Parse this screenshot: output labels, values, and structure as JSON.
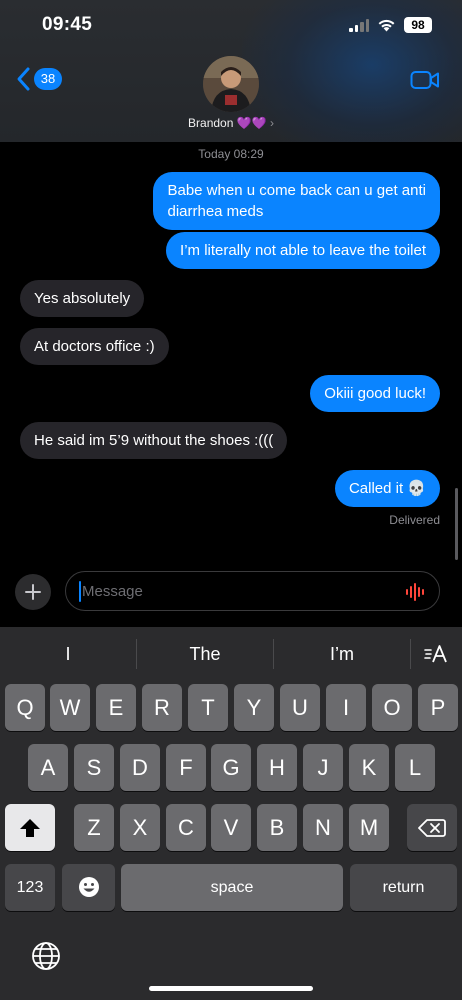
{
  "status_bar": {
    "time": "09:45",
    "battery": "98"
  },
  "header": {
    "back_badge": "38",
    "contact_name": "Brandon 💜💜",
    "contact_chevron": "›"
  },
  "conversation": {
    "timestamp": "Today 08:29",
    "messages": [
      {
        "from": "me",
        "text_lines": [
          "Babe when u come back can u get anti",
          "diarrhea meds"
        ]
      },
      {
        "from": "me",
        "text": "I’m literally not able to leave the toilet"
      },
      {
        "from": "them",
        "text": "Yes absolutely"
      },
      {
        "from": "them",
        "text": "At doctors office :)"
      },
      {
        "from": "me",
        "text": "Okiii good luck!"
      },
      {
        "from": "them",
        "text": "He said im 5’9 without the shoes :((("
      },
      {
        "from": "me",
        "text": "Called it 💀"
      }
    ],
    "delivered": "Delivered"
  },
  "composer": {
    "placeholder": "Message"
  },
  "keyboard": {
    "predictions": [
      "I",
      "The",
      "I’m"
    ],
    "row1": [
      "Q",
      "W",
      "E",
      "R",
      "T",
      "Y",
      "U",
      "I",
      "O",
      "P"
    ],
    "row2": [
      "A",
      "S",
      "D",
      "F",
      "G",
      "H",
      "J",
      "K",
      "L"
    ],
    "row3": [
      "Z",
      "X",
      "C",
      "V",
      "B",
      "N",
      "M"
    ],
    "numbers_label": "123",
    "space_label": "space",
    "return_label": "return"
  },
  "colors": {
    "accent": "#0a84ff",
    "incoming_bubble": "#26252a",
    "keyboard_bg": "#2b2b2d",
    "key_bg": "#6b6b6e",
    "voice_icon": "#ff453a"
  },
  "icons": {
    "back": "chevron-left-icon",
    "video": "video-camera-icon",
    "add": "plus-icon",
    "voice": "waveform-icon",
    "shift": "shift-arrow-icon",
    "delete": "backspace-icon",
    "emoji": "emoji-face-icon",
    "globe": "globe-icon",
    "format": "text-format-icon"
  }
}
